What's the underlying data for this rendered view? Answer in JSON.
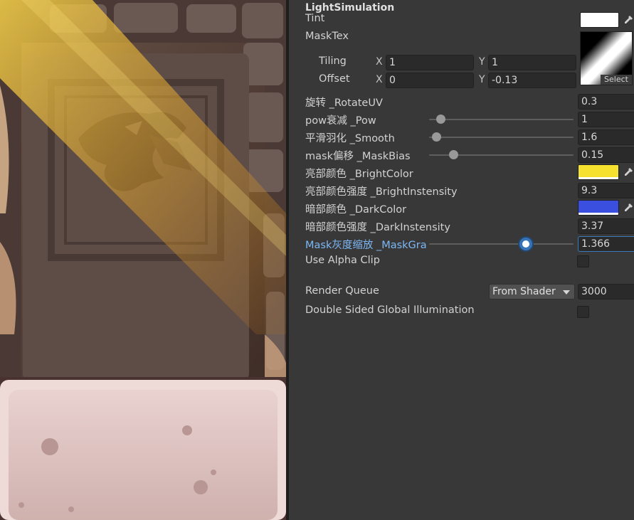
{
  "inspector": {
    "shader_title": "LightSimulation",
    "tint": {
      "label": "Tint",
      "color": "#ffffff"
    },
    "mask_tex": {
      "label": "MaskTex",
      "select_label": "Select",
      "tiling": {
        "label": "Tiling",
        "x_axis": "X",
        "x": "1",
        "y_axis": "Y",
        "y": "1"
      },
      "offset": {
        "label": "Offset",
        "x_axis": "X",
        "x": "0",
        "y_axis": "Y",
        "y": "-0.13"
      }
    },
    "rotate_uv": {
      "label": "旋转 _RotateUV",
      "value": "0.3"
    },
    "pow": {
      "label": "pow衰减 _Pow",
      "value": "1",
      "slider": 0.08
    },
    "smooth": {
      "label": "平滑羽化 _Smooth",
      "value": "1.6",
      "slider": 0.05
    },
    "mask_bias": {
      "label": "mask偏移 _MaskBias",
      "value": "0.15",
      "slider": 0.17
    },
    "bright_color": {
      "label": "亮部颜色 _BrightColor",
      "color": "#f5e12e"
    },
    "bright_intensity": {
      "label": "亮部颜色强度 _BrightInstensity",
      "value": "9.3"
    },
    "dark_color": {
      "label": "暗部颜色 _DarkColor",
      "color": "#3a4ee0"
    },
    "dark_intensity": {
      "label": "暗部颜色强度 _DarkInstensity",
      "value": "3.37"
    },
    "mask_gray_scale": {
      "label": "Mask灰度缩放 _MaskGra",
      "value": "1.366",
      "slider": 0.67
    },
    "use_alpha_clip": {
      "label": "Use Alpha Clip",
      "checked": false
    },
    "render_queue": {
      "label": "Render Queue",
      "mode": "From Shader",
      "value": "3000"
    },
    "double_sided_gi": {
      "label": "Double Sided Global Illumination",
      "checked": false
    }
  },
  "icons": {
    "eyedropper": "eyedropper-icon",
    "dropdown": "chevron-down-icon"
  }
}
